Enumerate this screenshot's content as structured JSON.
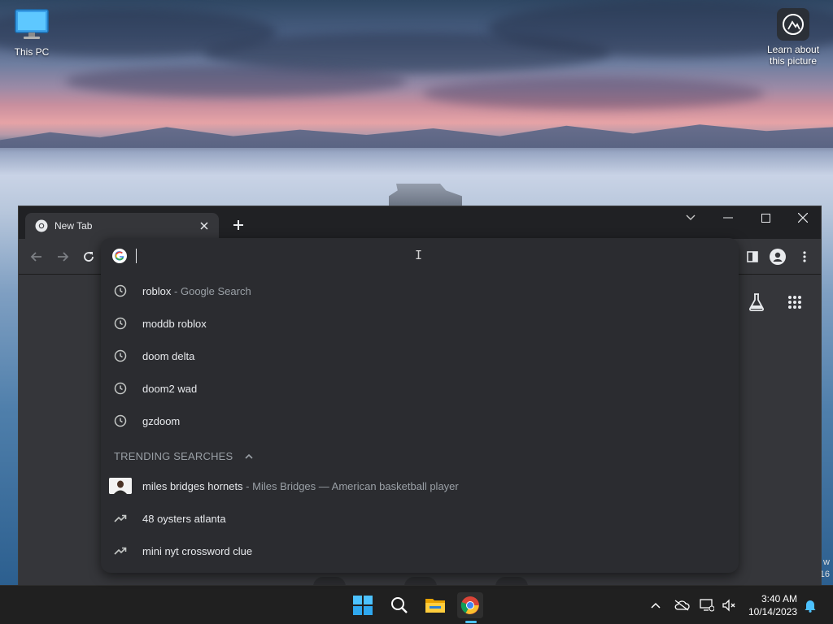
{
  "desktop": {
    "this_pc_label": "This PC",
    "learn_label_line1": "Learn about",
    "learn_label_line2": "this picture",
    "edge_text_1": "w",
    "edge_text_2": "16"
  },
  "browser": {
    "tab_title": "New Tab",
    "omnibox_value": "",
    "suggestions": [
      {
        "text": "roblox",
        "sep": " - ",
        "desc": "Google Search",
        "icon": "history-icon"
      },
      {
        "text": "moddb roblox",
        "icon": "history-icon"
      },
      {
        "text": "doom delta",
        "icon": "history-icon"
      },
      {
        "text": "doom2 wad",
        "icon": "history-icon"
      },
      {
        "text": "gzdoom",
        "icon": "history-icon"
      }
    ],
    "trending_header": "TRENDING SEARCHES",
    "trending": [
      {
        "text": "miles bridges hornets",
        "sep": " - ",
        "desc": "Miles Bridges — American basketball player",
        "icon": "person-thumbnail"
      },
      {
        "text": "48 oysters atlanta",
        "icon": "trending-icon"
      },
      {
        "text": "mini nyt crossword clue",
        "icon": "trending-icon"
      }
    ]
  },
  "taskbar": {
    "time": "3:40 AM",
    "date": "10/14/2023"
  },
  "colors": {
    "window_bg": "#202124",
    "toolbar_bg": "#35363a",
    "dropdown_bg": "#2b2c30",
    "text_primary": "#e8eaed",
    "text_secondary": "#9aa0a6",
    "accent": "#4cc2ff"
  }
}
